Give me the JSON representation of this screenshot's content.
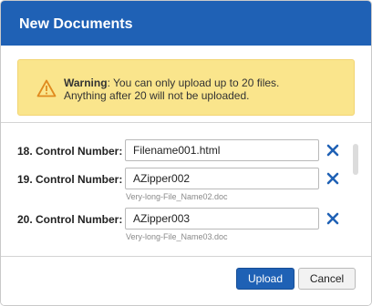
{
  "dialog": {
    "title": "New Documents"
  },
  "warning": {
    "icon": "warning-triangle-icon",
    "bold": "Warning",
    "line1": ": You can only upload up to 20 files.",
    "line2": "Anything after 20 will not be uploaded.",
    "background": "#fae58c",
    "icon_color": "#e08a1e"
  },
  "rows": [
    {
      "label": "18. Control Number:",
      "value": "Filename001.html",
      "filename": ""
    },
    {
      "label": "19. Control Number:",
      "value": "AZipper002",
      "filename": "Very-long-File_Name02.doc"
    },
    {
      "label": "20. Control Number:",
      "value": "AZipper003",
      "filename": "Very-long-File_Name03.doc"
    }
  ],
  "remove_icon": "close-x-icon",
  "buttons": {
    "upload": "Upload",
    "cancel": "Cancel"
  },
  "colors": {
    "accent": "#1f61b5",
    "remove": "#1f61b5"
  }
}
